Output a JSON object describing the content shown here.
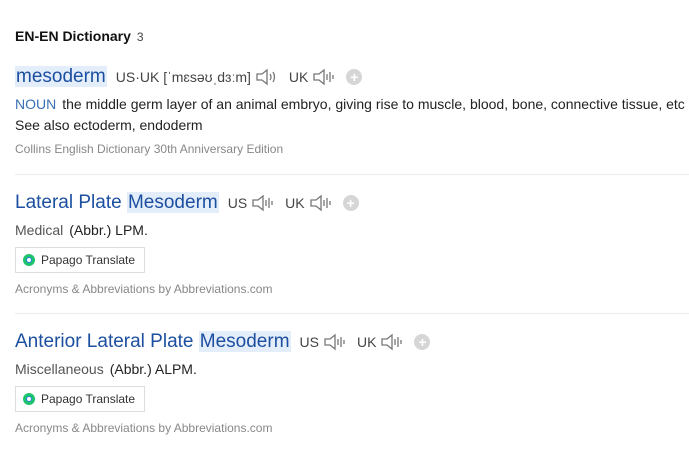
{
  "header": {
    "title": "EN-EN Dictionary",
    "count": "3"
  },
  "entries": [
    {
      "word": "mesoderm",
      "pron_us_uk": "US·UK [ˈmɛsəʊˌdɜːm]",
      "uk_label": "UK",
      "pos": "NOUN",
      "definition": "the middle germ layer of an animal embryo, giving rise to muscle, blood, bone, connective tissue, etc",
      "see_also": "See also ectoderm, endoderm",
      "source": "Collins English Dictionary 30th Anniversary Edition"
    },
    {
      "word_prefix": "Lateral Plate ",
      "word_highlight": "Mesoderm",
      "us_label": "US",
      "uk_label": "UK",
      "field": "Medical",
      "definition": "(Abbr.) LPM.",
      "translate_label": "Papago Translate",
      "source": "Acronyms & Abbreviations by Abbreviations.com"
    },
    {
      "word_prefix": "Anterior Lateral Plate ",
      "word_highlight": "Mesoderm",
      "us_label": "US",
      "uk_label": "UK",
      "field": "Miscellaneous",
      "definition": "(Abbr.) ALPM.",
      "translate_label": "Papago Translate",
      "source": "Acronyms & Abbreviations by Abbreviations.com"
    }
  ],
  "icons": {
    "speaker": "speaker-icon",
    "add": "add-icon",
    "papago": "papago-icon"
  }
}
